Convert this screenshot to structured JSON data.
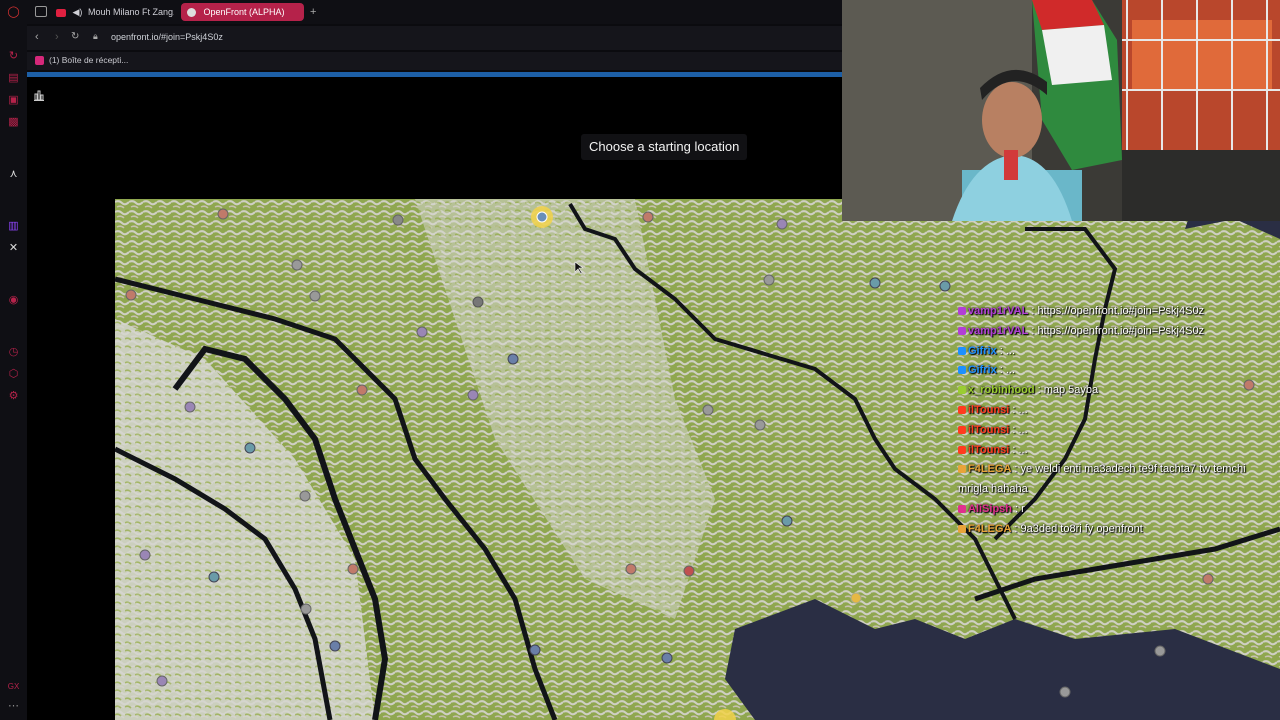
{
  "browser": {
    "tabs": [
      {
        "label": "Mouh Milano Ft Zang...",
        "active": false
      },
      {
        "label": "OpenFront (ALPHA)",
        "active": true
      }
    ],
    "new_tab_symbol": "+",
    "url": "openfront.io/#join=Pskj4S0z",
    "bookmark": "(1) Boîte de récepti...",
    "left_rail_icons": [
      "opera-icon",
      "refresh-icon",
      "bag-icon",
      "wallet-icon",
      "mail-icon",
      "arrow-icon",
      "twitch-icon",
      "x-icon",
      "play-icon",
      "clock-icon",
      "rocket-icon",
      "settings-icon",
      "gx-icon",
      "more-icon"
    ]
  },
  "game": {
    "instruction": "Choose a starting location",
    "stats_icon": "bar-chart-icon"
  },
  "chat": [
    {
      "user": "vamp1rVAL",
      "user_color": "#b23fd6",
      "text": ": https://openfront.io#join=Pskj4S0z"
    },
    {
      "user": "vamp1rVAL",
      "user_color": "#b23fd6",
      "text": ": https://openfront.io#join=Pskj4S0z"
    },
    {
      "user": "Gifrix",
      "user_color": "#1e90ff",
      "text": ": ..."
    },
    {
      "user": "Gifrix",
      "user_color": "#1e90ff",
      "text": ": ..."
    },
    {
      "user": "x_robinhood",
      "user_color": "#9acd32",
      "text": ": map 5ayba"
    },
    {
      "user": "ilTounsi",
      "user_color": "#ff3b1f",
      "text": ": ..."
    },
    {
      "user": "ilTounsi",
      "user_color": "#ff3b1f",
      "text": ": ..."
    },
    {
      "user": "ilTounsi",
      "user_color": "#ff3b1f",
      "text": ": ..."
    },
    {
      "user": "F4LEGA",
      "user_color": "#e8a33a",
      "text": ": ye weldi enti ma3adech te9f tachta7 tw temchi mrigla hahaha"
    },
    {
      "user": "AliSipsh",
      "user_color": "#e0308e",
      "text": ": r"
    },
    {
      "user": "F4LEGA",
      "user_color": "#e8a33a",
      "text": ": 9a3ded to8ri fy openfront"
    }
  ],
  "colors": {
    "accent_tab": "#b5224a",
    "map_green": "#93ab52",
    "map_land_light": "#d8d8d2",
    "water": "#2a2e44",
    "river": "#111418"
  }
}
